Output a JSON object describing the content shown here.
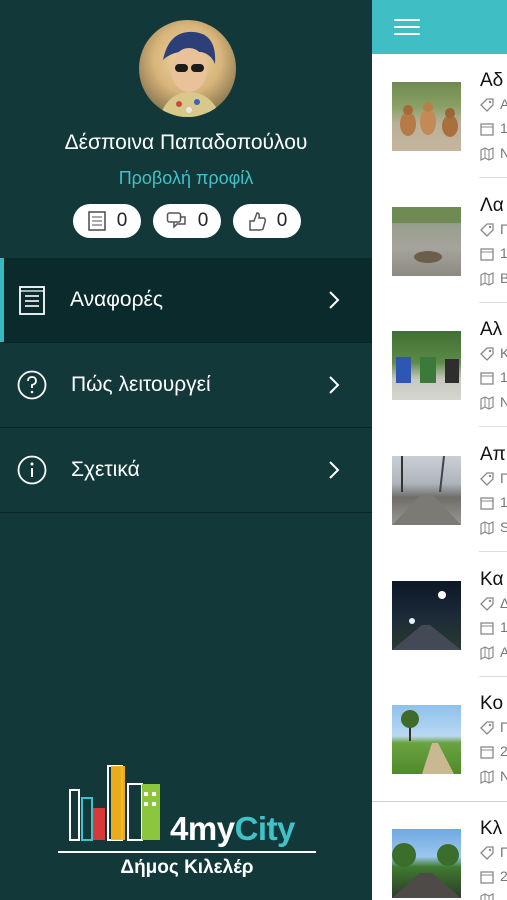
{
  "profile": {
    "name": "Δέσποινα Παπαδοπούλου",
    "view_profile": "Προβολή προφίλ",
    "stats": [
      {
        "icon": "document-icon",
        "value": "0"
      },
      {
        "icon": "comments-icon",
        "value": "0"
      },
      {
        "icon": "thumbs-up-icon",
        "value": "0"
      }
    ]
  },
  "menu": {
    "items": [
      {
        "label": "Αναφορές",
        "icon": "document-list-icon",
        "active": true
      },
      {
        "label": "Πώς λειτουργεί",
        "icon": "question-circle-icon",
        "active": false
      },
      {
        "label": "Σχετικά",
        "icon": "info-circle-icon",
        "active": false
      }
    ]
  },
  "brand": {
    "logo_text_a": "4my",
    "logo_text_b": "City",
    "municipality": "Δήμος Κιλελέρ"
  },
  "reports": [
    {
      "title": "Αδ",
      "category": "Α",
      "date": "1",
      "place": "Ν"
    },
    {
      "title": "Λα",
      "category": "Π",
      "date": "1",
      "place": "Β"
    },
    {
      "title": "Αλ",
      "category": "Κ",
      "date": "1",
      "place": "Ν"
    },
    {
      "title": "Απ",
      "category": "Π",
      "date": "1",
      "place": "S"
    },
    {
      "title": "Κα",
      "category": "Δ",
      "date": "1",
      "place": "Α"
    },
    {
      "title": "Κο",
      "category": "Π",
      "date": "2",
      "place": "Ν"
    },
    {
      "title": "Κλ",
      "category": "Π",
      "date": "2",
      "place": ""
    }
  ],
  "colors": {
    "accent": "#3fc3c8",
    "drawer": "#12383a",
    "topbar": "#3fbfc4"
  }
}
